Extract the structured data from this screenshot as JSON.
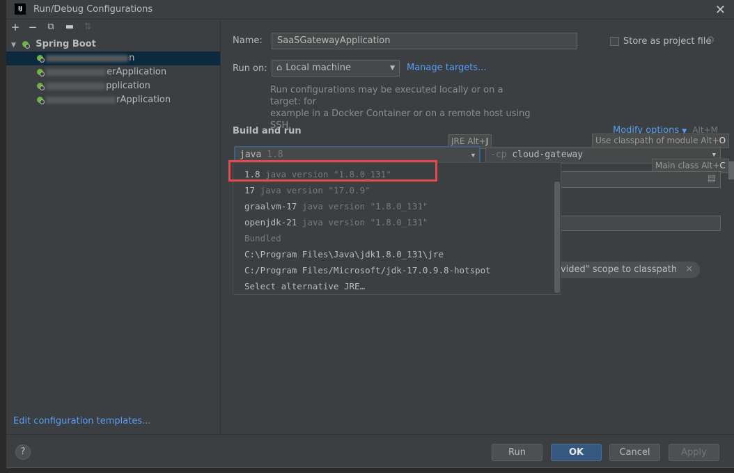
{
  "window": {
    "title": "Run/Debug Configurations",
    "logo": "IJ"
  },
  "toolbar": {
    "icons": [
      "add-icon",
      "remove-icon",
      "copy-icon",
      "folder-icon",
      "sort-icon"
    ]
  },
  "tree": {
    "group_label": "Spring Boot",
    "items": [
      {
        "suffix": "n",
        "selected": true
      },
      {
        "suffix": "erApplication",
        "selected": false
      },
      {
        "suffix": "pplication",
        "selected": false
      },
      {
        "suffix": "rApplication",
        "selected": false
      }
    ]
  },
  "left_footer": {
    "edit_templates": "Edit configuration templates..."
  },
  "form": {
    "name_label": "Name:",
    "name_value": "SaaSGatewayApplication",
    "store_label": "Store as project file",
    "run_on_label": "Run on:",
    "run_on_value": "Local machine",
    "manage_targets": "Manage targets...",
    "hint_line1": "Run configurations may be executed locally or on a target: for",
    "hint_line2": "example in a Docker Container or on a remote host using SSH.",
    "section_title": "Build and run",
    "modify_options": "Modify options",
    "modify_shortcut": "Alt+M",
    "jre_tooltip_prefix": "JRE Alt+",
    "jre_tooltip_key": "J",
    "jre_value": "java",
    "jre_version": "1.8",
    "cp_prefix": "-cp",
    "cp_value": "cloud-gateway",
    "cp_tooltip_prefix": "Use classpath of module Alt+",
    "cp_tooltip_key": "O",
    "main_tooltip_prefix": "Main class Alt+",
    "main_tooltip_key": "C",
    "chip_text": "ovided\" scope to classpath"
  },
  "jre_popup": {
    "items": [
      {
        "name": "1.8",
        "detail": "java version \"1.8.0_131\""
      },
      {
        "name": "17",
        "detail": "java version \"17.0.9\""
      },
      {
        "name": "graalvm-17",
        "detail": "java version \"1.8.0_131\""
      },
      {
        "name": "openjdk-21",
        "detail": "java version \"1.8.0_131\""
      }
    ],
    "group_label": "Bundled",
    "paths": [
      "C:\\Program Files\\Java\\jdk1.8.0_131\\jre",
      "C:/Program Files/Microsoft/jdk-17.0.9.8-hotspot"
    ],
    "alternative": "Select alternative JRE…"
  },
  "buttons": {
    "help": "?",
    "run": "Run",
    "ok": "OK",
    "cancel": "Cancel",
    "apply": "Apply"
  },
  "colors": {
    "accent": "#589df6",
    "primary_button": "#365880",
    "highlight_box": "#e5484d",
    "spring_green": "#6db33f"
  }
}
